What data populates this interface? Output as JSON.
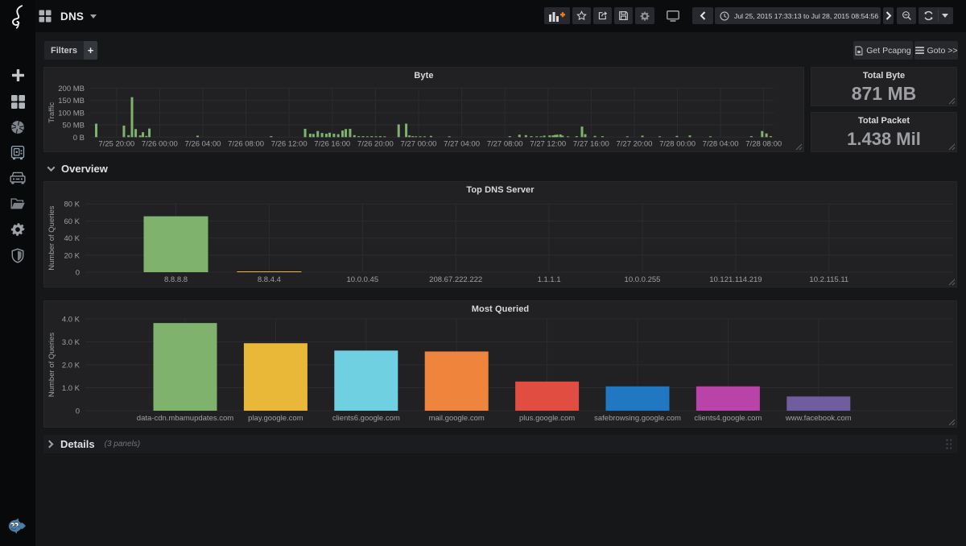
{
  "navbar": {
    "title": "DNS",
    "time_range": "Jul 25, 2015 17:33:13 to Jul 28, 2015 08:54:56",
    "actions": [
      "add-panel",
      "star",
      "share",
      "save",
      "settings"
    ],
    "view_mode": "tv",
    "time_controls": [
      "back",
      "time-range",
      "forward",
      "zoom-out",
      "refresh",
      "refresh-interval"
    ]
  },
  "sidebar": {
    "items": [
      "create",
      "dashboards",
      "capture",
      "vault",
      "storage",
      "files",
      "settings",
      "security"
    ],
    "mascot": "fish"
  },
  "toolbar": {
    "filters_label": "Filters",
    "add_filter_label": "+",
    "get_pcapng_label": "Get Pcapng",
    "goto_label": "Goto >>"
  },
  "rows": {
    "overview_title": "Overview",
    "details_title": "Details",
    "details_note": "(3 panels)"
  },
  "stats": [
    {
      "title": "Total Byte",
      "value": "871 MB"
    },
    {
      "title": "Total Packet",
      "value": "1.438 Mil"
    }
  ],
  "colors": {
    "green": "#7EB26D",
    "yellow": "#EAB839",
    "cyan": "#6ED0E0",
    "orange": "#EF843C",
    "red": "#E24D42",
    "blue": "#1F78C1",
    "magenta": "#BA43A9",
    "violet": "#705DA0",
    "accent_plus": "#eb7b18"
  },
  "chart_data": [
    {
      "type": "bar",
      "title": "Byte",
      "ylabel": "Traffic",
      "xlabel": "",
      "ylim": [
        0,
        200
      ],
      "y_unit": "MB",
      "ytick_labels": [
        "0 B",
        "50 MB",
        "100 MB",
        "150 MB",
        "200 MB"
      ],
      "xtick_labels": [
        "7/25 20:00",
        "7/26 00:00",
        "7/26 04:00",
        "7/26 08:00",
        "7/26 12:00",
        "7/26 16:00",
        "7/26 20:00",
        "7/27 00:00",
        "7/27 04:00",
        "7/27 08:00",
        "7/27 12:00",
        "7/27 16:00",
        "7/27 20:00",
        "7/28 00:00",
        "7/28 04:00",
        "7/28 08:00"
      ],
      "x_unit": "hours since Jul 25, 2015 17:33:13",
      "series": [
        {
          "name": "Traffic",
          "color": "#7EB26D",
          "points": [
            [
              0.56,
              55
            ],
            [
              3.13,
              47
            ],
            [
              3.56,
              8
            ],
            [
              3.88,
              163
            ],
            [
              4.22,
              33
            ],
            [
              4.64,
              7
            ],
            [
              4.89,
              20
            ],
            [
              5.21,
              5
            ],
            [
              5.49,
              35
            ],
            [
              9.96,
              6
            ],
            [
              16.78,
              4
            ],
            [
              19.93,
              34
            ],
            [
              20.4,
              14
            ],
            [
              20.7,
              13
            ],
            [
              21.1,
              25
            ],
            [
              21.5,
              17
            ],
            [
              21.9,
              14
            ],
            [
              22.2,
              18
            ],
            [
              22.6,
              14
            ],
            [
              23.0,
              12
            ],
            [
              23.4,
              27
            ],
            [
              23.7,
              33
            ],
            [
              24.1,
              34
            ],
            [
              24.5,
              8
            ],
            [
              24.9,
              4
            ],
            [
              25.3,
              4
            ],
            [
              25.7,
              3
            ],
            [
              26.1,
              4
            ],
            [
              26.5,
              3
            ],
            [
              26.9,
              4
            ],
            [
              27.3,
              3
            ],
            [
              28.6,
              52
            ],
            [
              29.3,
              55
            ],
            [
              29.6,
              7
            ],
            [
              29.9,
              4
            ],
            [
              30.2,
              3
            ],
            [
              30.6,
              3
            ],
            [
              31.0,
              3
            ],
            [
              31.6,
              5
            ],
            [
              33.3,
              3
            ],
            [
              38.9,
              4
            ],
            [
              39.8,
              10
            ],
            [
              40.4,
              8
            ],
            [
              40.9,
              4
            ],
            [
              41.4,
              3
            ],
            [
              41.8,
              3
            ],
            [
              42.1,
              6
            ],
            [
              42.6,
              7
            ],
            [
              42.9,
              7
            ],
            [
              43.1,
              9
            ],
            [
              43.3,
              10
            ],
            [
              43.6,
              11
            ],
            [
              43.8,
              6
            ],
            [
              44.3,
              2
            ],
            [
              45.1,
              4
            ],
            [
              45.6,
              43
            ],
            [
              45.9,
              12
            ],
            [
              46.8,
              5
            ],
            [
              47.5,
              4
            ],
            [
              49.8,
              3
            ],
            [
              51.2,
              6
            ],
            [
              52.8,
              3
            ],
            [
              54.4,
              5
            ],
            [
              55.6,
              7
            ],
            [
              57.5,
              3
            ],
            [
              61.3,
              4
            ],
            [
              62.3,
              25
            ],
            [
              62.7,
              15
            ],
            [
              63.1,
              4
            ]
          ]
        }
      ]
    },
    {
      "type": "bar",
      "title": "Top DNS Server",
      "ylabel": "Number of Queries",
      "xlabel": "",
      "ylim": [
        0,
        80000
      ],
      "ytick_labels": [
        "0",
        "20 K",
        "40 K",
        "60 K",
        "80 K"
      ],
      "categories": [
        "8.8.8.8",
        "8.8.4.4",
        "10.0.0.45",
        "208.67.222.222",
        "1.1.1.1",
        "10.0.0.255",
        "10.121.114.219",
        "10.2.115.11"
      ],
      "values": [
        65500,
        800,
        0,
        0,
        0,
        0,
        0,
        0
      ],
      "colors": [
        "#7EB26D",
        "#EAB839",
        "#6ED0E0",
        "#EF843C",
        "#E24D42",
        "#1F78C1",
        "#BA43A9",
        "#705DA0"
      ]
    },
    {
      "type": "bar",
      "title": "Most Queried",
      "ylabel": "Number of Queries",
      "xlabel": "",
      "ylim": [
        0,
        4000
      ],
      "ytick_labels": [
        "0",
        "1.0 K",
        "2.0 K",
        "3.0 K",
        "4.0 K"
      ],
      "categories": [
        "data-cdn.mbamupdates.com",
        "play.google.com",
        "clients6.google.com",
        "mail.google.com",
        "plus.google.com",
        "safebrowsing.google.com",
        "clients4.google.com",
        "www.facebook.com"
      ],
      "values": [
        3820,
        2940,
        2620,
        2580,
        1270,
        1060,
        1060,
        620
      ],
      "colors": [
        "#7EB26D",
        "#EAB839",
        "#6ED0E0",
        "#EF843C",
        "#E24D42",
        "#1F78C1",
        "#BA43A9",
        "#705DA0"
      ]
    }
  ]
}
